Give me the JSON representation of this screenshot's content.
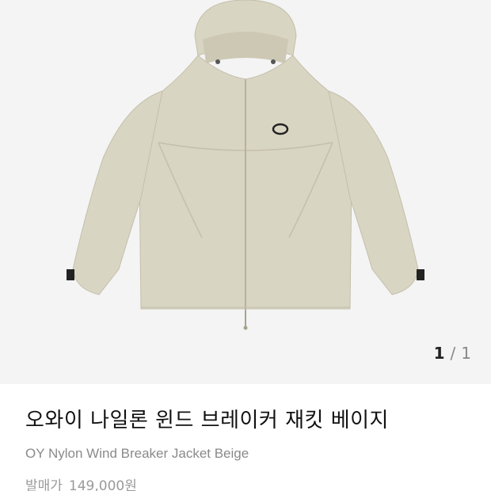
{
  "product": {
    "image_alt": "beige nylon wind breaker jacket",
    "title_ko": "오와이 나일론 윈드 브레이커 재킷 베이지",
    "title_en": "OY Nylon Wind Breaker Jacket Beige",
    "price_label": "발매가",
    "price": "149,000원"
  },
  "gallery": {
    "current": "1",
    "separator": "/",
    "total": "1"
  },
  "colors": {
    "jacket": "#d9d5c3",
    "jacket_shadow": "#c4bfab",
    "background": "#f4f4f4"
  }
}
